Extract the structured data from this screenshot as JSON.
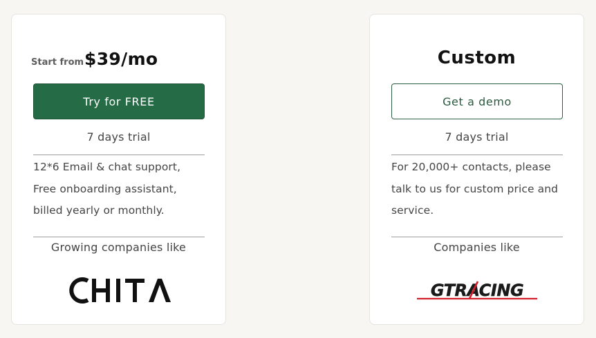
{
  "plans": [
    {
      "price_prefix": "Start from",
      "price": "$39/mo",
      "cta_label": "Try for FREE",
      "trial": "7 days trial",
      "description": [
        "12*6 Email & chat support,",
        "Free onboarding assistant,",
        "billed yearly or monthly."
      ],
      "companies_label": "Growing companies like",
      "logo_text": "CHITA"
    },
    {
      "title": "Custom",
      "cta_label": "Get a demo",
      "trial": "7 days trial",
      "description": [
        "For 20,000+ contacts, please",
        "talk to us for custom price and",
        "service."
      ],
      "companies_label": "Companies like",
      "logo_text": "GTRACING"
    }
  ],
  "colors": {
    "primary_green": "#256b45",
    "gt_red": "#d21f2b"
  }
}
